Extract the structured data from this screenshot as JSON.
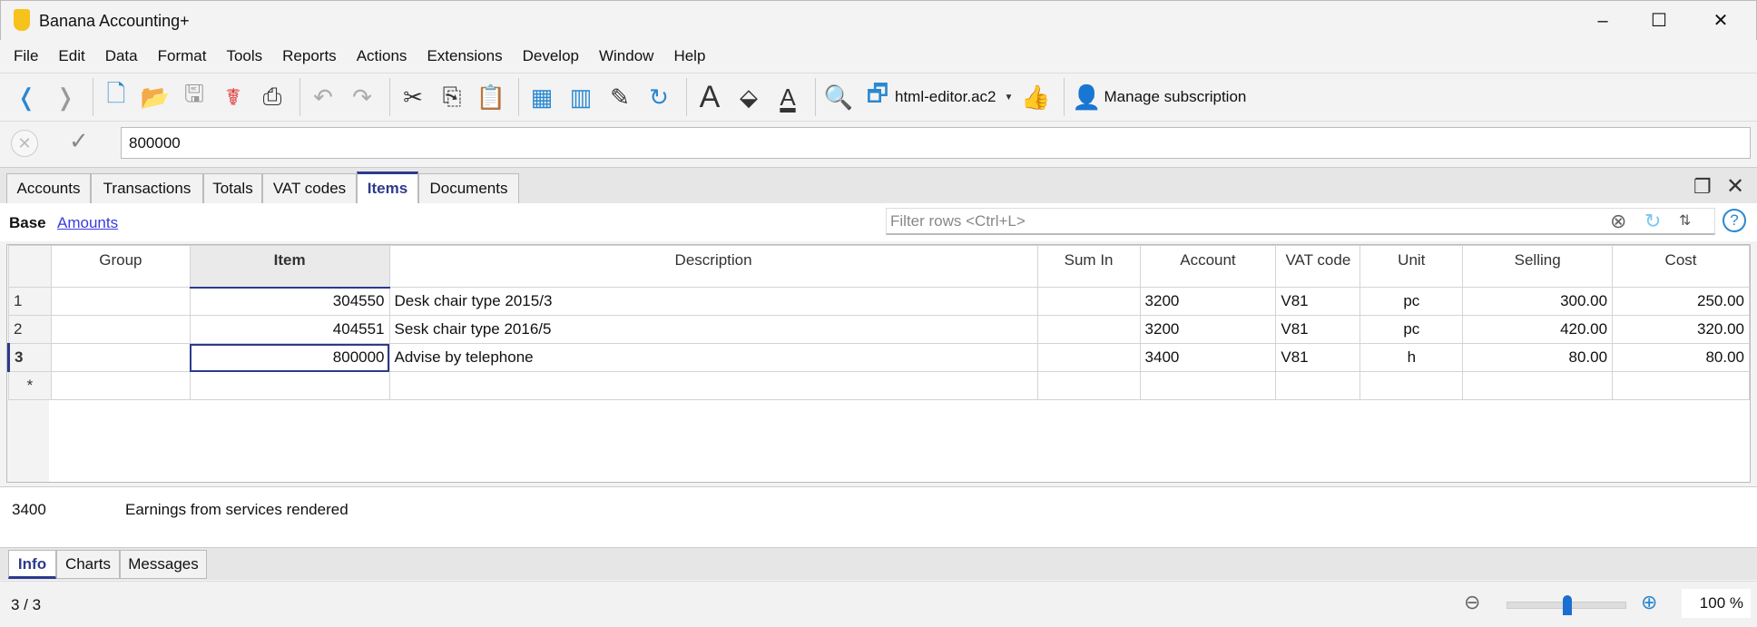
{
  "window": {
    "title": "Banana Accounting+",
    "minimize": "–",
    "maximize": "☐",
    "close": "✕"
  },
  "menu": [
    "File",
    "Edit",
    "Data",
    "Format",
    "Tools",
    "Reports",
    "Actions",
    "Extensions",
    "Develop",
    "Window",
    "Help"
  ],
  "toolbar": {
    "file_name": "html-editor.ac2",
    "subscription": "Manage subscription"
  },
  "editline": {
    "value": "800000"
  },
  "tabs": [
    "Accounts",
    "Transactions",
    "Totals",
    "VAT codes",
    "Items",
    "Documents"
  ],
  "views": {
    "base": "Base",
    "amounts": "Amounts"
  },
  "filter": {
    "placeholder": "Filter rows <Ctrl+L>"
  },
  "table": {
    "columns": [
      "Group",
      "Item",
      "Description",
      "Sum In",
      "Account",
      "VAT code",
      "Unit",
      "Selling",
      "Cost"
    ],
    "rows": [
      {
        "n": "1",
        "group": "",
        "item": "304550",
        "description": "Desk chair type 2015/3",
        "sumin": "",
        "account": "3200",
        "vat": "V81",
        "unit": "pc",
        "selling": "300.00",
        "cost": "250.00"
      },
      {
        "n": "2",
        "group": "",
        "item": "404551",
        "description": "Sesk chair type 2016/5",
        "sumin": "",
        "account": "3200",
        "vat": "V81",
        "unit": "pc",
        "selling": "420.00",
        "cost": "320.00"
      },
      {
        "n": "3",
        "group": "",
        "item": "800000",
        "description": "Advise by telephone",
        "sumin": "",
        "account": "3400",
        "vat": "V81",
        "unit": "h",
        "selling": "80.00",
        "cost": "80.00"
      }
    ],
    "new_row": "*"
  },
  "info": {
    "account": "3400",
    "text": "Earnings from services rendered"
  },
  "bottom_tabs": [
    "Info",
    "Charts",
    "Messages"
  ],
  "status": {
    "rows": "3 / 3",
    "zoom": "100 %",
    "zoom_level": 0.5
  }
}
